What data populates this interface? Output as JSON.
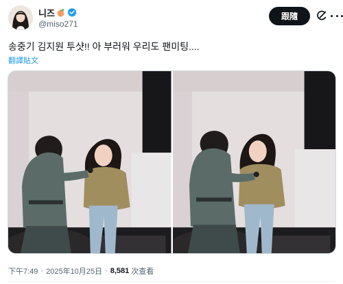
{
  "author": {
    "display_name": "니즈",
    "handle": "@miso271"
  },
  "actions": {
    "follow_label": "跟隨"
  },
  "tweet": {
    "text": "송중기 김지원 투샷!! 아 부러워 우리도 팬미팅....",
    "translate_label": "翻譯貼文"
  },
  "meta": {
    "time": "下午7:49",
    "date": "2025年10月25日",
    "views": "8,581",
    "views_label": "次查看",
    "separator": "·"
  },
  "icons": {
    "peach": "peach-emoji-icon",
    "verified": "verified-badge-icon",
    "grok": "grok-icon",
    "more": "more-icon"
  },
  "colors": {
    "follow_bg": "#0f1419",
    "link": "#1d9bf0",
    "verified": "#1d9bf0",
    "secondary_text": "#536471"
  }
}
